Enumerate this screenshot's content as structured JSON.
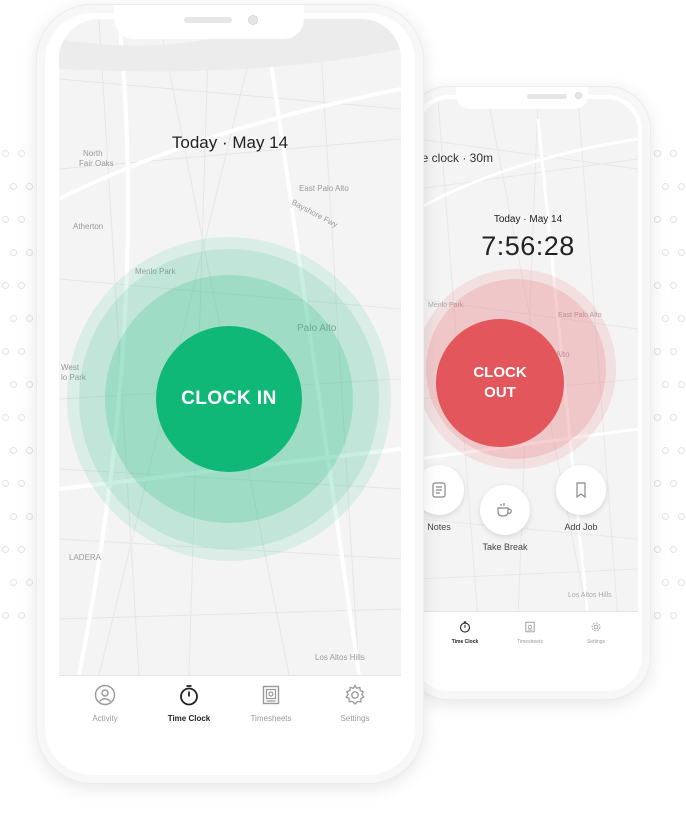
{
  "front": {
    "date": "Today · May 14",
    "clock_in_label": "CLOCK IN",
    "map_labels": [
      "North",
      "Fair Oaks",
      "East Palo Alto",
      "Bayshore Fwy",
      "Atherton",
      "Menlo Park",
      "Palo Alto",
      "West",
      "lo Park",
      "LADERA",
      "Los Altos Hills"
    ],
    "tabs": [
      {
        "label": "Activity",
        "icon": "person-circle-icon",
        "active": false
      },
      {
        "label": "Time Clock",
        "icon": "stopwatch-icon",
        "active": true
      },
      {
        "label": "Timesheets",
        "icon": "timesheet-icon",
        "active": false
      },
      {
        "label": "Settings",
        "icon": "gear-icon",
        "active": false
      }
    ]
  },
  "back": {
    "on_clock": "he clock  ·  30m",
    "date": "Today · May 14",
    "timer": "7:56:28",
    "clock_out_line1": "CLOCK",
    "clock_out_line2": "OUT",
    "actions": [
      {
        "label": "Notes",
        "icon": "notes-icon"
      },
      {
        "label": "Take Break",
        "icon": "coffee-cup-icon"
      },
      {
        "label": "Add Job",
        "icon": "bookmark-icon"
      }
    ],
    "tabs": [
      {
        "label": "Time Clock",
        "icon": "stopwatch-icon",
        "active": true
      },
      {
        "label": "Timesheets",
        "icon": "timesheet-icon",
        "active": false
      },
      {
        "label": "Settings",
        "icon": "gear-icon",
        "active": false
      }
    ]
  },
  "colors": {
    "clock_in": "#10b878",
    "clock_out": "#e3565b",
    "map_bg": "#f4f4f4"
  }
}
